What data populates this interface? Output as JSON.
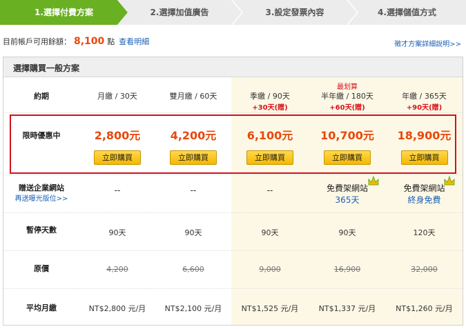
{
  "steps": [
    {
      "label": "1.選擇付費方案",
      "active": true
    },
    {
      "label": "2.選擇加值廣告",
      "active": false
    },
    {
      "label": "3.設定發票內容",
      "active": false
    },
    {
      "label": "4.選擇儲值方式",
      "active": false
    }
  ],
  "balance": {
    "label": "目前帳戶可用餘額：",
    "amount": "8,100",
    "unit": "點",
    "detail_link": "查看明細"
  },
  "plan_link": "徵才方案詳細說明>>",
  "panel_title": "選擇購買一般方案",
  "row_labels": {
    "period": "約期",
    "promo": "限時優惠中",
    "gift": "贈送企業網站",
    "gift_sub": "再送曝光版位>>",
    "pause": "暫停天數",
    "original": "原價",
    "avg": "平均月繳"
  },
  "plans": [
    {
      "period": "月繳 / 30天",
      "bonus": "",
      "tag": "",
      "price": "2,800元",
      "buy": "立即購買",
      "gift": "--",
      "gift_sub": "",
      "pause": "90天",
      "original": "4,200",
      "avg": "NT$2,800 元/月"
    },
    {
      "period": "雙月繳 / 60天",
      "bonus": "",
      "tag": "",
      "price": "4,200元",
      "buy": "立即購買",
      "gift": "--",
      "gift_sub": "",
      "pause": "90天",
      "original": "6,600",
      "avg": "NT$2,100 元/月"
    },
    {
      "period": "季繳 / 90天",
      "bonus": "+30天(贈)",
      "tag": "",
      "price": "6,100元",
      "buy": "立即購買",
      "gift": "--",
      "gift_sub": "",
      "pause": "90天",
      "original": "9,000",
      "avg": "NT$1,525 元/月"
    },
    {
      "period": "半年繳 / 180天",
      "bonus": "+60天(贈)",
      "tag": "最划算",
      "price": "10,700元",
      "buy": "立即購買",
      "gift": "免費架網站",
      "gift_sub": "365天",
      "pause": "90天",
      "original": "16,900",
      "avg": "NT$1,337 元/月"
    },
    {
      "period": "年繳 / 365天",
      "bonus": "+90天(贈)",
      "tag": "",
      "price": "18,900元",
      "buy": "立即購買",
      "gift": "免費架網站",
      "gift_sub": "終身免費",
      "pause": "120天",
      "original": "32,000",
      "avg": "NT$1,260 元/月"
    }
  ],
  "colors": {
    "step_active": "#6ab023",
    "step_inactive": "#ececec",
    "price": "#e8480c",
    "bonus": "#d8121a",
    "highlight_bg": "#fdf8e6",
    "red_box": "#d0111b"
  }
}
